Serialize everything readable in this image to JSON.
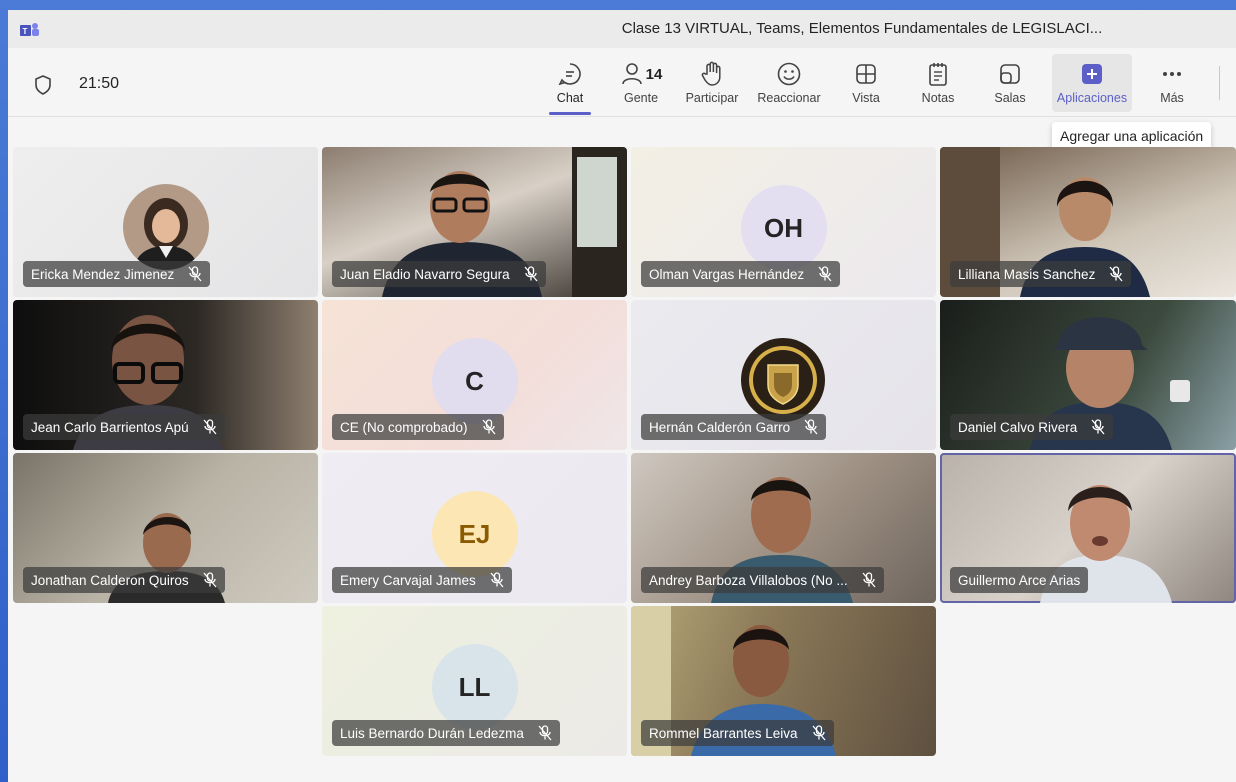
{
  "window": {
    "title": "Clase 13 VIRTUAL, Teams, Elementos Fundamentales de LEGISLACI..."
  },
  "toolbar": {
    "timer": "21:50",
    "chat": "Chat",
    "people": "Gente",
    "people_count": "14",
    "raise": "Participar",
    "react": "Reaccionar",
    "view": "Vista",
    "notes": "Notas",
    "rooms": "Salas",
    "apps": "Aplicaciones",
    "more": "Más"
  },
  "tooltip": "Agregar una aplicación",
  "participants": [
    {
      "name": "Ericka Mendez Jimenez",
      "type": "photo-avatar"
    },
    {
      "name": "Juan Eladio Navarro Segura",
      "type": "video"
    },
    {
      "name": "Olman Vargas Hernández",
      "type": "initials",
      "initials": "OH"
    },
    {
      "name": "Lilliana Masis Sanchez",
      "type": "video"
    },
    {
      "name": "Jean Carlo Barrientos Apú",
      "type": "video"
    },
    {
      "name": "CE (No comprobado)",
      "type": "initials",
      "initials": "C"
    },
    {
      "name": "Hernán Calderón Garro",
      "type": "logo-avatar"
    },
    {
      "name": "Daniel Calvo Rivera",
      "type": "video"
    },
    {
      "name": "Jonathan Calderon Quiros",
      "type": "video"
    },
    {
      "name": "Emery Carvajal James",
      "type": "initials",
      "initials": "EJ"
    },
    {
      "name": "Andrey Barboza Villalobos (No ...",
      "type": "video"
    },
    {
      "name": "Guillermo Arce Arias",
      "type": "video",
      "speaking": true
    },
    {
      "name": "Luis Bernardo Durán Ledezma",
      "type": "initials",
      "initials": "LL"
    },
    {
      "name": "Rommel Barrantes Leiva",
      "type": "video"
    }
  ],
  "colors": {
    "accent": "#5b5fc7",
    "highlight": "#6264a7"
  }
}
